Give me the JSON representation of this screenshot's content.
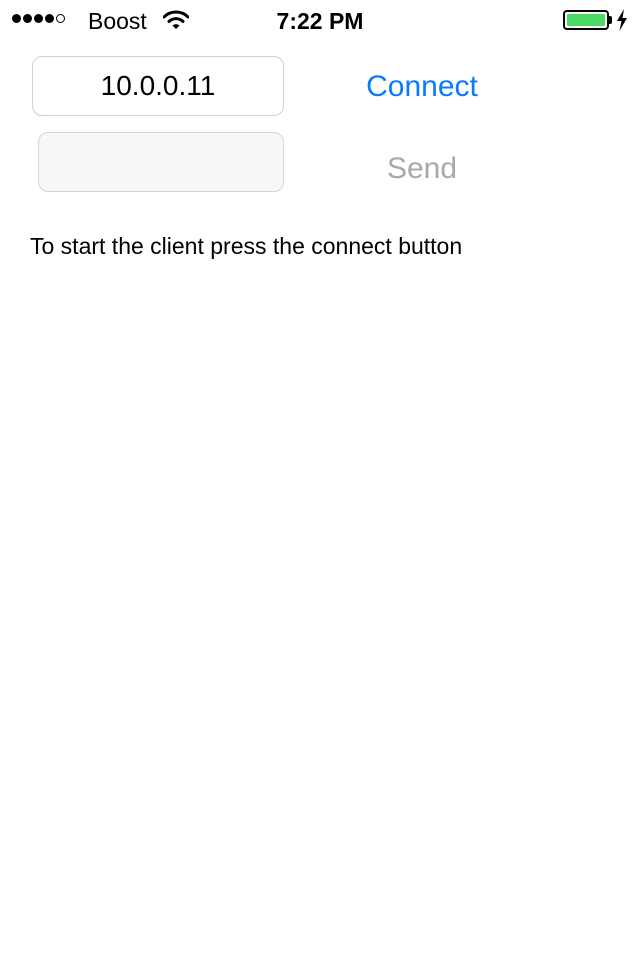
{
  "status_bar": {
    "signal_bars_filled": 4,
    "signal_bars_total": 5,
    "carrier": "Boost",
    "wifi_icon": "wifi-icon",
    "time": "7:22 PM",
    "battery_level": 1.0,
    "battery_color": "#4cd964",
    "charging_icon": "bolt-icon"
  },
  "form": {
    "host_value": "10.0.0.11",
    "message_value": "",
    "connect_label": "Connect",
    "send_label": "Send",
    "accent_color": "#0a7aff",
    "disabled_color": "#a9a9a9"
  },
  "instructions": "To start the client press the connect button"
}
